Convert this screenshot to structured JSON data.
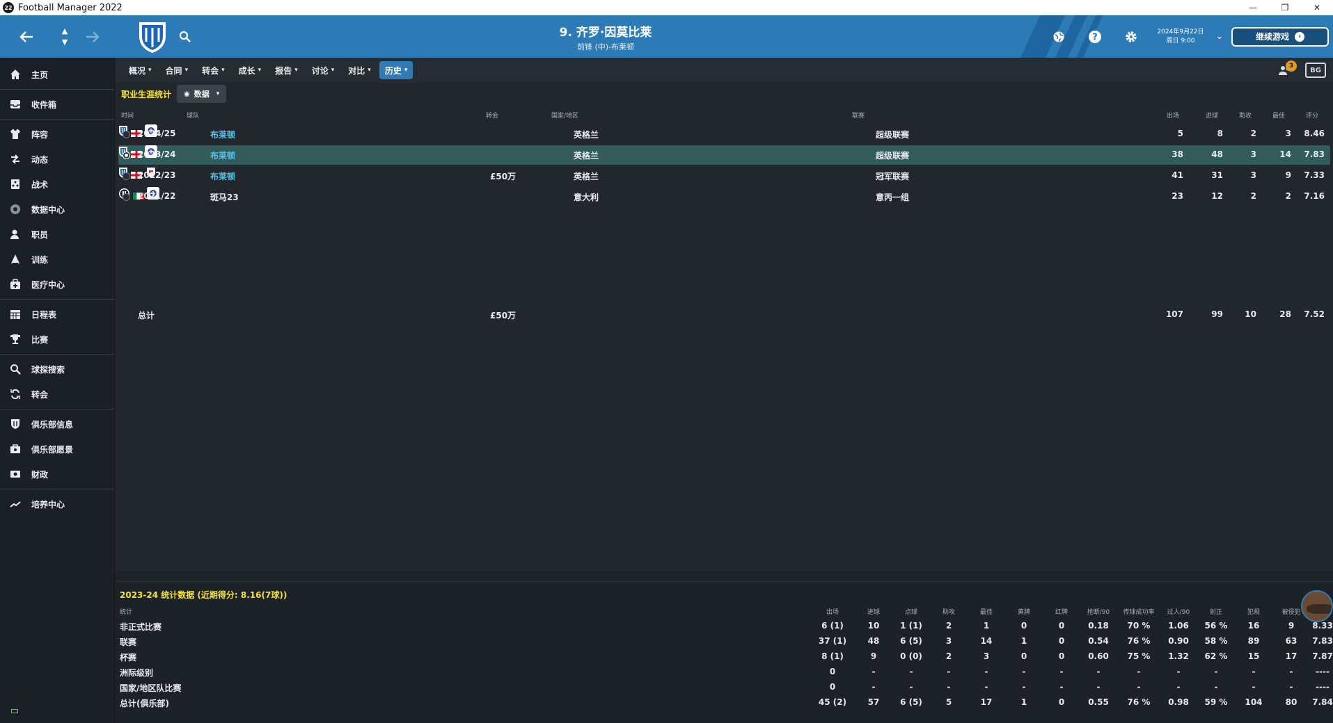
{
  "window": {
    "app_badge": "22",
    "title": "Football Manager 2022",
    "minimize": "—",
    "restore": "❐",
    "close": "✕"
  },
  "header": {
    "player_name": "9. 齐罗·因莫比莱",
    "player_sub": "前锋 (中)-布莱顿",
    "date_line1": "2024年9月22日",
    "date_line2": "周日 9:00",
    "continue_label": "继续游戏",
    "accent": "#2c7bb6"
  },
  "sidebar": {
    "items": [
      {
        "label": "主页",
        "icon": "home-icon"
      },
      {
        "label": "收件箱",
        "icon": "inbox-icon"
      },
      {
        "label": "阵容",
        "icon": "shirt-icon"
      },
      {
        "label": "动态",
        "icon": "dynamics-icon"
      },
      {
        "label": "战术",
        "icon": "tactics-icon"
      },
      {
        "label": "数据中心",
        "icon": "data-hub-icon"
      },
      {
        "label": "职员",
        "icon": "staff-icon"
      },
      {
        "label": "训练",
        "icon": "training-icon"
      },
      {
        "label": "医疗中心",
        "icon": "medical-icon"
      },
      {
        "label": "日程表",
        "icon": "calendar-icon"
      },
      {
        "label": "比赛",
        "icon": "trophy-icon"
      },
      {
        "label": "球探搜索",
        "icon": "scouting-icon"
      },
      {
        "label": "转会",
        "icon": "transfer-icon"
      },
      {
        "label": "俱乐部信息",
        "icon": "club-info-icon"
      },
      {
        "label": "俱乐部愿景",
        "icon": "club-vision-icon"
      },
      {
        "label": "财政",
        "icon": "finance-icon"
      },
      {
        "label": "培养中心",
        "icon": "development-icon"
      }
    ]
  },
  "tabs": [
    "概况",
    "合同",
    "转会",
    "成长",
    "报告",
    "讨论",
    "对比",
    "历史"
  ],
  "active_tab": "历史",
  "notifications_count": "3",
  "kit_label": "BG",
  "career": {
    "title": "职业生涯统计",
    "view_label": "数据",
    "columns": {
      "year": "时间",
      "team": "球队",
      "transfer": "转会",
      "nation": "国家/地区",
      "league": "联赛",
      "apps": "出场",
      "goals": "进球",
      "assists": "助攻",
      "pom": "最佳",
      "rating": "评分"
    },
    "rows": [
      {
        "year": "2024/25",
        "team": "布莱顿",
        "transfer": "",
        "nation": "英格兰",
        "league": "超级联赛",
        "apps": "5",
        "goals": "8",
        "assists": "2",
        "pom": "3",
        "rating": "8.46",
        "selected": false
      },
      {
        "year": "2023/24",
        "team": "布莱顿",
        "transfer": "",
        "nation": "英格兰",
        "league": "超级联赛",
        "apps": "38",
        "goals": "48",
        "assists": "3",
        "pom": "14",
        "rating": "7.83",
        "selected": true
      },
      {
        "year": "2022/23",
        "team": "布莱顿",
        "transfer": "£50万",
        "nation": "英格兰",
        "league": "冠军联赛",
        "apps": "41",
        "goals": "31",
        "assists": "3",
        "pom": "9",
        "rating": "7.33",
        "selected": false
      },
      {
        "year": "2021/22",
        "team": "斑马23",
        "transfer": "",
        "nation": "意大利",
        "league": "意丙一组",
        "apps": "23",
        "goals": "12",
        "assists": "2",
        "pom": "2",
        "rating": "7.16",
        "selected": false
      }
    ],
    "total": {
      "label": "总计",
      "transfer": "£50万",
      "apps": "107",
      "goals": "99",
      "assists": "10",
      "pom": "28",
      "rating": "7.52"
    }
  },
  "season_stats": {
    "title": "2023-24 统计数据 (近期得分: 8.16(7球))",
    "columns": [
      "统计",
      "出场",
      "进球",
      "点球",
      "助攻",
      "最佳",
      "黄牌",
      "红牌",
      "抢断/90",
      "传球成功率",
      "过人/90",
      "射正",
      "犯规",
      "被侵犯",
      ""
    ],
    "rows": [
      [
        "非正式比赛",
        "6 (1)",
        "10",
        "1 (1)",
        "2",
        "1",
        "0",
        "0",
        "0.18",
        "70 %",
        "1.06",
        "56 %",
        "16",
        "9",
        "8.33"
      ],
      [
        "联赛",
        "37 (1)",
        "48",
        "6 (5)",
        "3",
        "14",
        "1",
        "0",
        "0.54",
        "76 %",
        "0.90",
        "58 %",
        "89",
        "63",
        "7.83"
      ],
      [
        "杯赛",
        "8 (1)",
        "9",
        "0 (0)",
        "2",
        "3",
        "0",
        "0",
        "0.60",
        "75 %",
        "1.32",
        "62 %",
        "15",
        "17",
        "7.87"
      ],
      [
        "洲际级别",
        "0",
        "-",
        "-",
        "-",
        "-",
        "-",
        "-",
        "-",
        "-",
        "-",
        "-",
        "-",
        "-",
        "----"
      ],
      [
        "国家/地区队比赛",
        "0",
        "-",
        "-",
        "-",
        "-",
        "-",
        "-",
        "-",
        "-",
        "-",
        "-",
        "-",
        "-",
        "----"
      ],
      [
        "总计(俱乐部)",
        "45 (2)",
        "57",
        "6 (5)",
        "5",
        "17",
        "1",
        "0",
        "0.55",
        "76 %",
        "0.98",
        "59 %",
        "104",
        "80",
        "7.84"
      ]
    ]
  }
}
